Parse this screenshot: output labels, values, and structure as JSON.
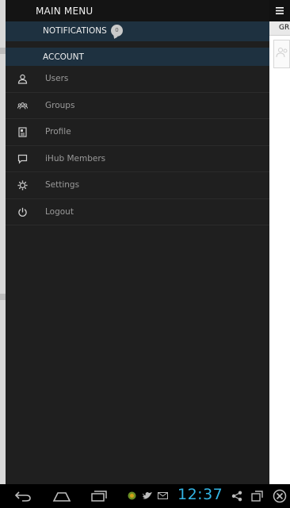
{
  "drawer": {
    "header_title": "MAIN MENU",
    "notifications": {
      "label": "NOTIFICATIONS",
      "count": "0"
    },
    "account_label": "ACCOUNT",
    "items": [
      {
        "label": "Users",
        "icon": "user-icon"
      },
      {
        "label": "Groups",
        "icon": "groups-icon"
      },
      {
        "label": "Profile",
        "icon": "profile-icon"
      },
      {
        "label": "iHub Members",
        "icon": "chat-bubble-icon"
      },
      {
        "label": "Settings",
        "icon": "gear-icon"
      },
      {
        "label": "Logout",
        "icon": "power-icon"
      }
    ]
  },
  "content": {
    "tab_label": "GR"
  },
  "status_bar": {
    "time": "12:37"
  },
  "colors": {
    "drawer_bg": "#1f1f1f",
    "section_bg": "#1e3140",
    "clock": "#33b5e5"
  }
}
